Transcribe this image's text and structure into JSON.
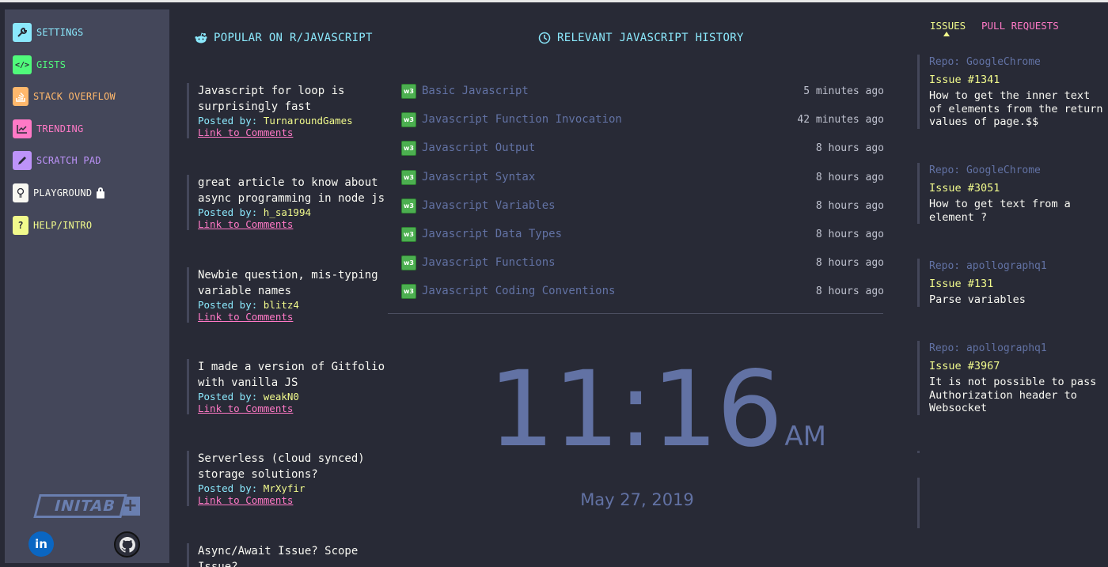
{
  "sidebar": {
    "items": [
      {
        "label": "SETTINGS",
        "icon": "wrench-icon",
        "color": "#8be9fd",
        "bg": "#8be9fd",
        "glyph": "🔧"
      },
      {
        "label": "GISTS",
        "icon": "code-icon",
        "color": "#50fa7b",
        "bg": "#50fa7b",
        "glyph": "</>"
      },
      {
        "label": "STACK OVERFLOW",
        "icon": "stack-overflow-icon",
        "color": "#ffb86c",
        "bg": "#ffb86c",
        "glyph": "≡"
      },
      {
        "label": "TRENDING",
        "icon": "chart-icon",
        "color": "#ff79c6",
        "bg": "#ff79c6",
        "glyph": "~"
      },
      {
        "label": "SCRATCH PAD",
        "icon": "pencil-icon",
        "color": "#bd93f9",
        "bg": "#bd93f9",
        "glyph": "✎"
      },
      {
        "label": "PLAYGROUND",
        "icon": "bulb-icon",
        "color": "#f8f8f2",
        "bg": "#f8f8f2",
        "glyph": "◯"
      },
      {
        "label": "HELP/INTRO",
        "icon": "question-icon",
        "color": "#f1fa8c",
        "bg": "#f1fa8c",
        "glyph": "?"
      }
    ],
    "logo_text": "INITAB",
    "logo_plus": "+",
    "linkedin_text": "in"
  },
  "reddit": {
    "heading": "POPULAR ON R/JAVASCRIPT",
    "posted_label": "Posted by:",
    "link_label": "Link to Comments",
    "posts": [
      {
        "title": "Javascript for loop is surprisingly fast",
        "user": "TurnaroundGames"
      },
      {
        "title": "great article to know about async programming in node js",
        "user": "h_sa1994"
      },
      {
        "title": "Newbie question, mis-typing variable names",
        "user": "blitz4"
      },
      {
        "title": "I made a version of Gitfolio with vanilla JS",
        "user": "weakN0"
      },
      {
        "title": "Serverless (cloud synced) storage solutions?",
        "user": "MrXyfir"
      },
      {
        "title": "Async/Await Issue? Scope Issue?",
        "user": ""
      }
    ]
  },
  "history": {
    "heading": "RELEVANT JAVASCRIPT HISTORY",
    "badge": "w3",
    "items": [
      {
        "title": "Basic Javascript",
        "time": "5 minutes ago"
      },
      {
        "title": "Javascript Function Invocation",
        "time": "42 minutes ago"
      },
      {
        "title": "Javascript Output",
        "time": "8 hours ago"
      },
      {
        "title": "Javascript Syntax",
        "time": "8 hours ago"
      },
      {
        "title": "Javascript Variables",
        "time": "8 hours ago"
      },
      {
        "title": "Javascript Data Types",
        "time": "8 hours ago"
      },
      {
        "title": "Javascript Functions",
        "time": "8 hours ago"
      },
      {
        "title": "Javascript Coding Conventions",
        "time": "8 hours ago"
      }
    ]
  },
  "clock": {
    "time": "11:16",
    "ampm": "AM",
    "date": "May 27, 2019"
  },
  "issues": {
    "tab_issues": "ISSUES",
    "tab_pull_requests": "PULL REQUESTS",
    "items": [
      {
        "repo": "Repo: GoogleChrome",
        "number": "Issue #1341",
        "title": "How to get the inner text of elements from the return values of page.$$"
      },
      {
        "repo": "Repo: GoogleChrome",
        "number": "Issue #3051",
        "title": "How to get text from a element ?"
      },
      {
        "repo": "Repo: apollographq1",
        "number": "Issue #131",
        "title": "Parse variables"
      },
      {
        "repo": "Repo: apollographq1",
        "number": "Issue #3967",
        "title": "It is not possible to pass Authorization header to Websocket"
      }
    ]
  }
}
